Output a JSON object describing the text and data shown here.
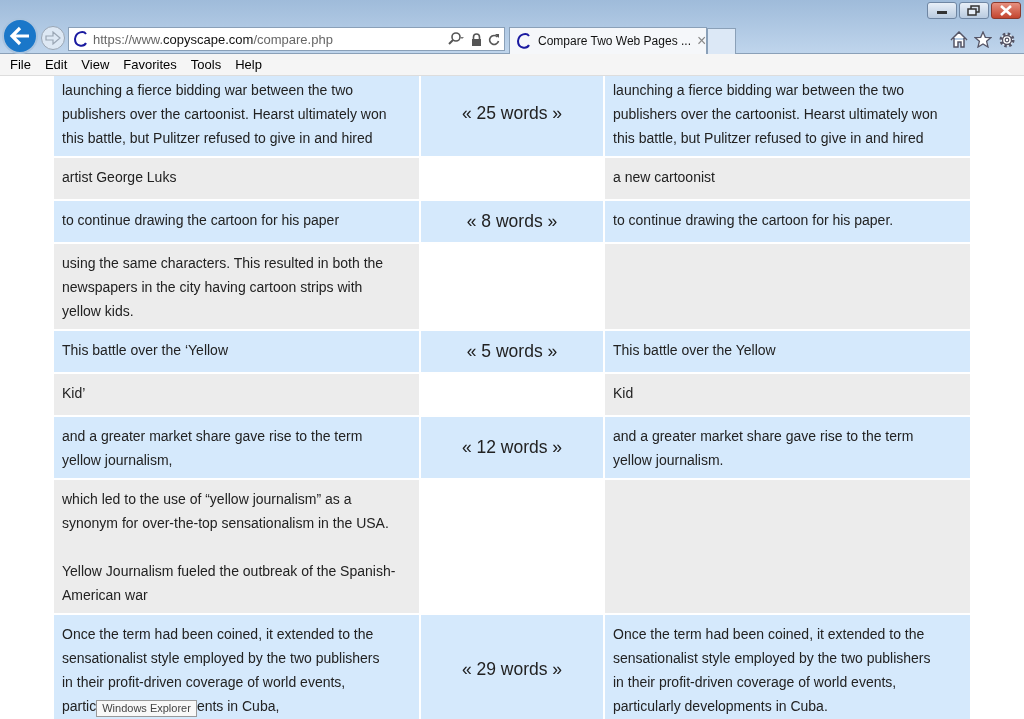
{
  "browser": {
    "url": {
      "scheme": "https://www.",
      "domain": "copyscape.com",
      "path": "/compare.php"
    },
    "tab": {
      "title": "Compare Two Web Pages ...",
      "close": "×",
      "selected": true
    },
    "menu": [
      "File",
      "Edit",
      "View",
      "Favorites",
      "Tools",
      "Help"
    ]
  },
  "rows": [
    {
      "kind": "match",
      "words": "« 25 words »",
      "left": [
        [
          "launching a fierce bidding war between the two",
          "publishers over the cartoonist. Hearst ultimately won",
          "this battle, but Pulitzer refused to give in and hired"
        ]
      ],
      "right": [
        [
          "launching a fierce bidding war between the two",
          "publishers over the cartoonist. Hearst ultimately won",
          "this battle, but Pulitzer refused to give in and hired"
        ]
      ]
    },
    {
      "kind": "gap",
      "left": [
        [
          "artist George Luks"
        ]
      ],
      "right": [
        [
          "a new cartoonist"
        ]
      ]
    },
    {
      "kind": "match",
      "words": "« 8 words »",
      "left": [
        [
          "to continue drawing the cartoon for his paper"
        ]
      ],
      "right": [
        [
          "to continue drawing the cartoon for his paper."
        ]
      ]
    },
    {
      "kind": "gap",
      "left": [
        [
          "using the same characters. This resulted in both the",
          "newspapers in the city having cartoon strips with",
          "yellow kids."
        ]
      ],
      "right": []
    },
    {
      "kind": "match",
      "words": "« 5 words »",
      "left": [
        [
          "This battle over the ‘Yellow"
        ]
      ],
      "right": [
        [
          "This battle over the Yellow"
        ]
      ]
    },
    {
      "kind": "gap",
      "left": [
        [
          "Kid’"
        ]
      ],
      "right": [
        [
          "Kid"
        ]
      ]
    },
    {
      "kind": "match",
      "words": "« 12 words »",
      "left": [
        [
          "and a greater market share gave rise to the term",
          "yellow journalism,"
        ]
      ],
      "right": [
        [
          "and a greater market share gave rise to the term",
          "yellow journalism."
        ]
      ]
    },
    {
      "kind": "gap",
      "left": [
        [
          "which led to the use of “yellow journalism” as a",
          "synonym for over-the-top sensationalism in the USA."
        ],
        [
          "Yellow Journalism fueled the outbreak of the Spanish-",
          "American war"
        ]
      ],
      "right": []
    },
    {
      "kind": "match",
      "words": "« 29 words »",
      "left": [
        [
          "Once the term had been coined, it extended to the",
          "sensationalist style employed by the two publishers",
          "in their profit-driven coverage of world events,"
        ]
      ],
      "covered_line": {
        "before": "partic",
        "after": "ents in Cuba,"
      },
      "right": [
        [
          "Once the term had been coined, it extended to the",
          "sensationalist style employed by the two publishers",
          "in their profit-driven coverage of world events,",
          "particularly developments in Cuba."
        ]
      ]
    }
  ],
  "tooltip": {
    "text": "Windows Explorer"
  }
}
